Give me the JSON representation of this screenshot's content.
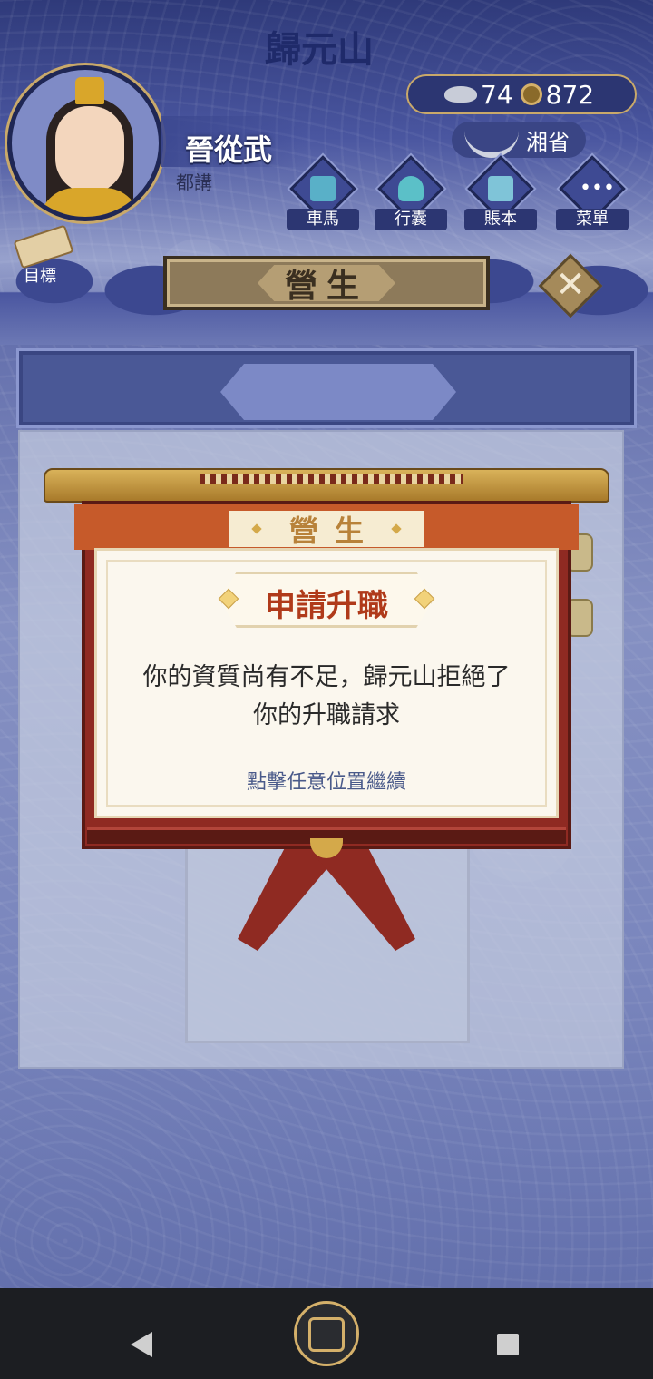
{
  "player": {
    "name": "晉從武",
    "rank": "都講"
  },
  "currency": {
    "silver": "74",
    "coins": "872"
  },
  "location_chip": "湘省",
  "menu": [
    {
      "label": "車馬",
      "icon": "carriage-icon"
    },
    {
      "label": "行囊",
      "icon": "bag-icon"
    },
    {
      "label": "賬本",
      "icon": "ledger-icon"
    },
    {
      "label": "菜單",
      "icon": "more-icon"
    }
  ],
  "goal_label": "目標",
  "page_title": "營生",
  "location_title": "歸元山",
  "dialog": {
    "header": "營生",
    "title": "申請升職",
    "message_line1": "你的資質尚有不足，歸元山拒絕了",
    "message_line2": "你的升職請求",
    "hint": "點擊任意位置繼續"
  },
  "colors": {
    "dialog_red": "#8f2a22",
    "accent_gold": "#d4a94a",
    "title_red": "#b03a1a"
  }
}
